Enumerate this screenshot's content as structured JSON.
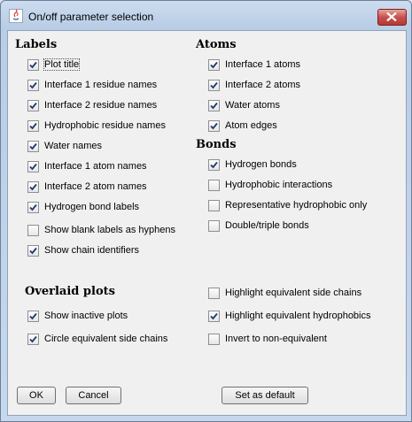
{
  "window": {
    "title": "On/off parameter selection"
  },
  "labels_section": {
    "heading": "Labels",
    "options": [
      {
        "label": "Plot title",
        "checked": true
      },
      {
        "label": "Interface 1 residue names",
        "checked": true
      },
      {
        "label": "Interface 2 residue names",
        "checked": true
      },
      {
        "label": "Hydrophobic residue names",
        "checked": true
      },
      {
        "label": "Water names",
        "checked": true
      },
      {
        "label": "Interface 1 atom names",
        "checked": true
      },
      {
        "label": "Interface 2 atom names",
        "checked": true
      },
      {
        "label": "Hydrogen bond labels",
        "checked": true
      },
      {
        "label": "Show blank labels as hyphens",
        "checked": false
      },
      {
        "label": "Show chain identifiers",
        "checked": true
      }
    ]
  },
  "atoms_section": {
    "heading": "Atoms",
    "options": [
      {
        "label": "Interface 1 atoms",
        "checked": true
      },
      {
        "label": "Interface 2 atoms",
        "checked": true
      },
      {
        "label": "Water atoms",
        "checked": true
      },
      {
        "label": "Atom edges",
        "checked": true
      }
    ]
  },
  "bonds_section": {
    "heading": "Bonds",
    "options": [
      {
        "label": "Hydrogen bonds",
        "checked": true
      },
      {
        "label": "Hydrophobic interactions",
        "checked": false
      },
      {
        "label": "Representative hydrophobic only",
        "checked": false
      },
      {
        "label": "Double/triple bonds",
        "checked": false
      }
    ]
  },
  "overlaid_section": {
    "heading": "Overlaid plots",
    "left_options": [
      {
        "label": "Show inactive plots",
        "checked": true
      },
      {
        "label": "Circle equivalent side chains",
        "checked": true
      }
    ],
    "right_options": [
      {
        "label": "Highlight equivalent side chains",
        "checked": false
      },
      {
        "label": "Highlight equivalent hydrophobics",
        "checked": true
      },
      {
        "label": "Invert to non-equivalent",
        "checked": false
      }
    ]
  },
  "buttons": {
    "ok": "OK",
    "cancel": "Cancel",
    "set_default": "Set as default"
  }
}
